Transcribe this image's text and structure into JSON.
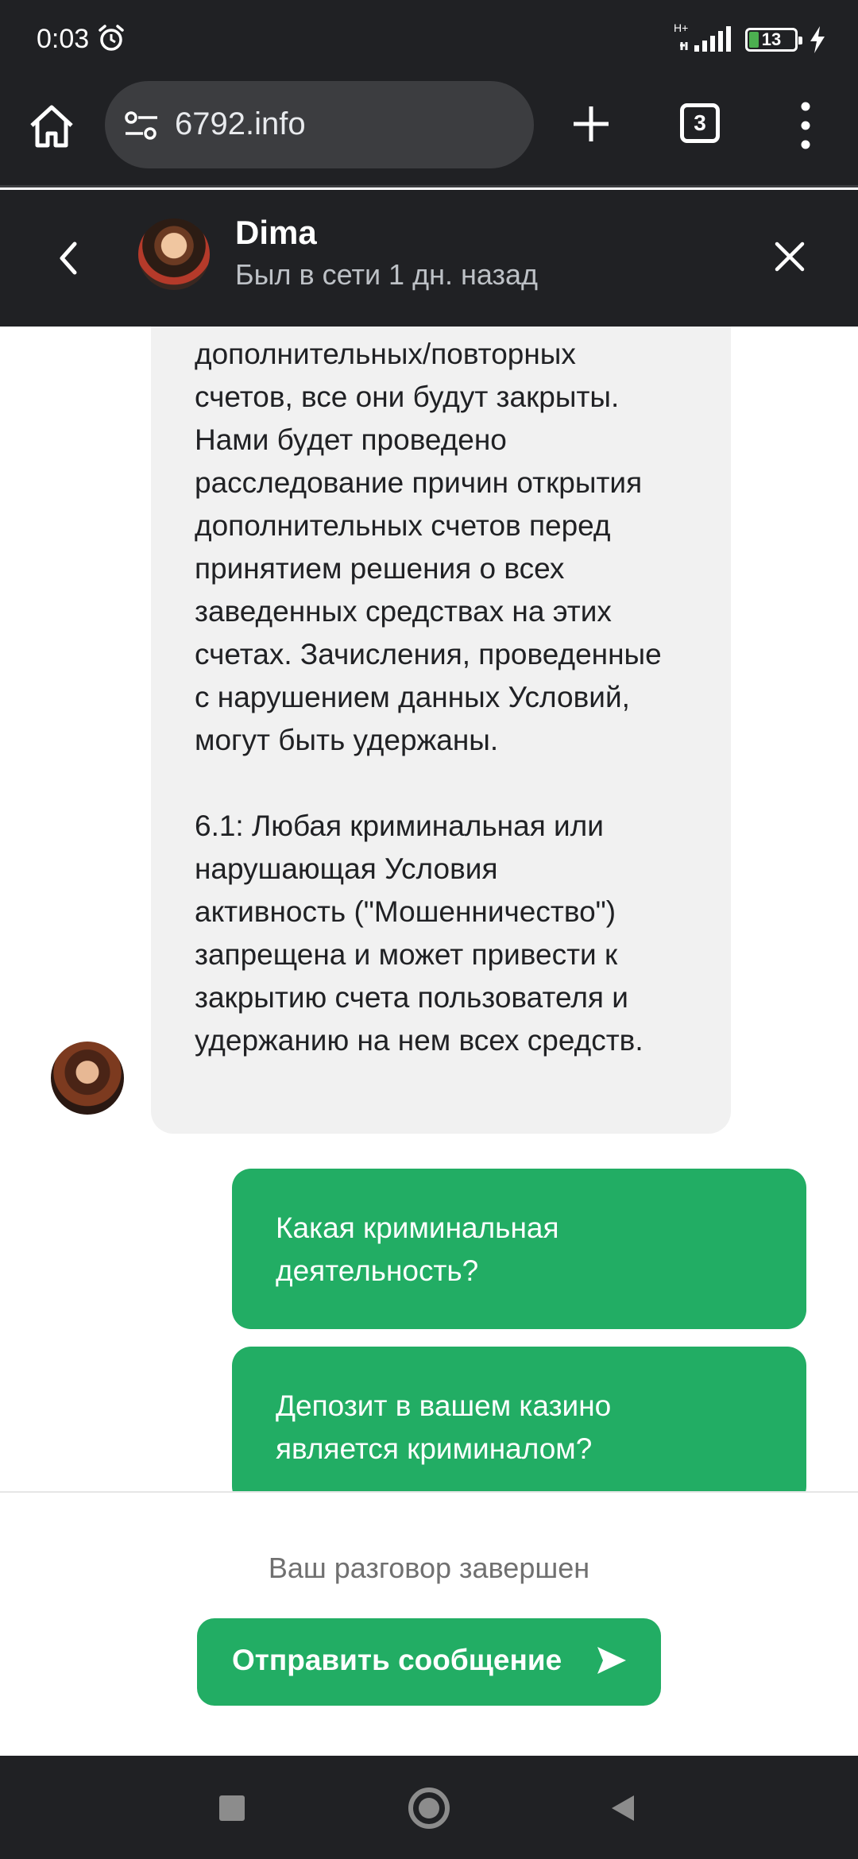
{
  "status_bar": {
    "time": "0:03",
    "network": "H+",
    "battery": "13",
    "icons": [
      "alarm-icon",
      "signal-icon",
      "battery-icon",
      "charging-icon"
    ]
  },
  "browser": {
    "url": "6792.info",
    "tab_count": "3",
    "icons": [
      "home-icon",
      "site-settings-icon",
      "new-tab-icon",
      "tabs-icon",
      "more-vert-icon"
    ]
  },
  "chat_header": {
    "name": "Dima",
    "status": "Был в сети 1 дн. назад",
    "icons": [
      "chevron-left-icon",
      "close-icon"
    ]
  },
  "messages": {
    "incoming": "дополнительных/повторных\nсчетов, все они будут закрыты.\nНами будет проведено\nрасследование причин открытия\nдополнительных счетов перед\nпринятием решения о всех\nзаведенных средствах на этих\nсчетах. Зачисления, проведенные\nс нарушением данных Условий,\nмогут быть удержаны.\n\n6.1: Любая криминальная или\nнарушающая Условия\nактивность (\"Мошенничество\")\nзапрещена и может привести к\nзакрытию счета пользователя и\nудержанию на нем всех средств.",
    "outgoing": [
      "Какая криминальная\nдеятельность?",
      "Депозит в вашем казино\nявляется криминалом?"
    ]
  },
  "footer": {
    "ended_text": "Ваш разговор завершен",
    "send_label": "Отправить сообщение"
  },
  "colors": {
    "accent": "#22ad64",
    "header_bg": "#202124",
    "incoming_bubble": "#f1f1f1"
  }
}
